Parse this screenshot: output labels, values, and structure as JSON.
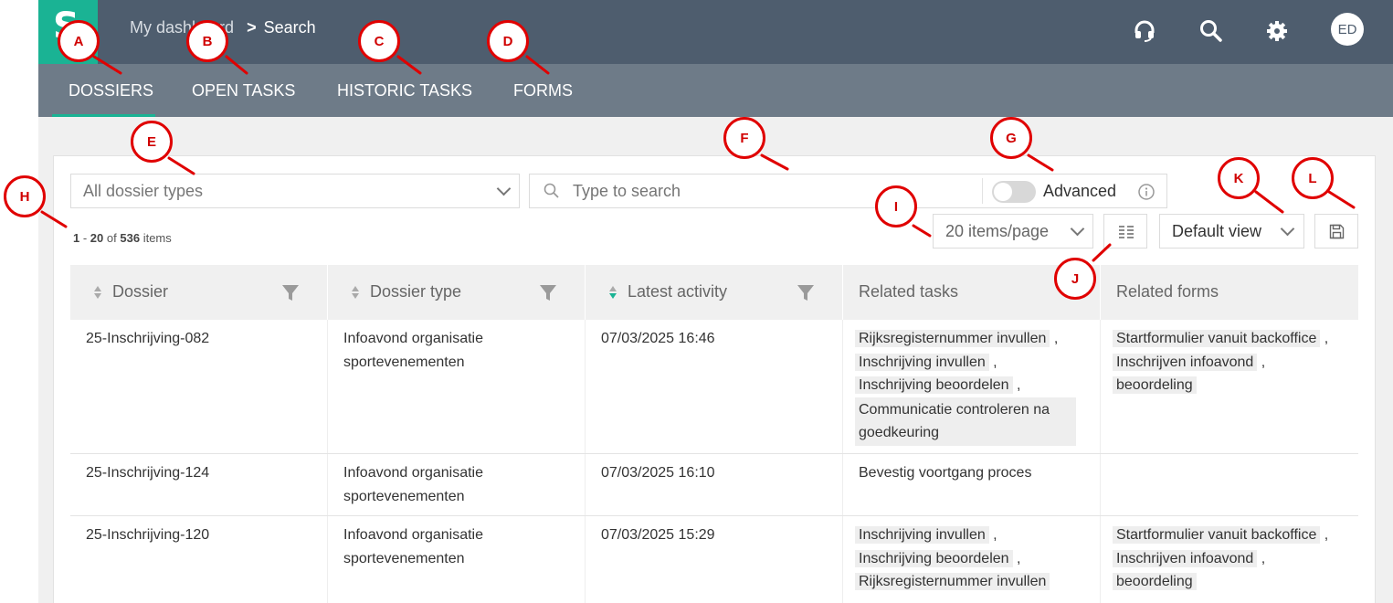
{
  "breadcrumb": {
    "home": "My dashboard",
    "separator": ">",
    "current": "Search"
  },
  "topbar": {
    "avatar_initials": "ED",
    "icons": [
      "headset-icon",
      "search-icon",
      "gear-icon"
    ]
  },
  "tabs": [
    {
      "label": "DOSSIERS",
      "active": true
    },
    {
      "label": "OPEN TASKS"
    },
    {
      "label": "HISTORIC TASKS"
    },
    {
      "label": "FORMS"
    }
  ],
  "filters": {
    "type_select": "All dossier types",
    "search_placeholder": "Type to search",
    "advanced_label": "Advanced",
    "page_size": "20 items/page",
    "view_select": "Default view"
  },
  "pagination": {
    "from": "1",
    "to": "20",
    "of": "of",
    "total": "536",
    "items": "items"
  },
  "table": {
    "columns": [
      "Dossier",
      "Dossier type",
      "Latest activity",
      "Related tasks",
      "Related forms"
    ],
    "rows": [
      {
        "dossier": "25-Inschrijving-082",
        "type_line1": "Infoavond organisatie",
        "type_line2": "sportevenementen",
        "activity": "07/03/2025 16:46",
        "tasks": [
          "Rijksregisternummer invullen",
          "Inschrijving invullen",
          "Inschrijving beoordelen",
          "Communicatie controleren na goedkeuring"
        ],
        "forms": [
          "Startformulier vanuit backoffice",
          "Inschrijven infoavond",
          "beoordeling"
        ]
      },
      {
        "dossier": "25-Inschrijving-124",
        "type_line1": "Infoavond organisatie",
        "type_line2": "sportevenementen",
        "activity": "07/03/2025 16:10",
        "tasks": [
          "Bevestig voortgang proces"
        ],
        "forms": []
      },
      {
        "dossier": "25-Inschrijving-120",
        "type_line1": "Infoavond organisatie",
        "type_line2": "sportevenementen",
        "activity": "07/03/2025 15:29",
        "tasks": [
          "Inschrijving invullen",
          "Inschrijving beoordelen",
          "Rijksregisternummer invullen"
        ],
        "forms": [
          "Startformulier vanuit backoffice",
          "Inschrijven infoavond",
          "beoordeling"
        ]
      }
    ]
  },
  "callouts": [
    "A",
    "B",
    "C",
    "D",
    "E",
    "F",
    "G",
    "H",
    "I",
    "J",
    "K",
    "L"
  ],
  "colors": {
    "topbar": "#4e5d6e",
    "tabbar": "#6e7b88",
    "accent": "#1ab394",
    "callout": "#e00000"
  }
}
